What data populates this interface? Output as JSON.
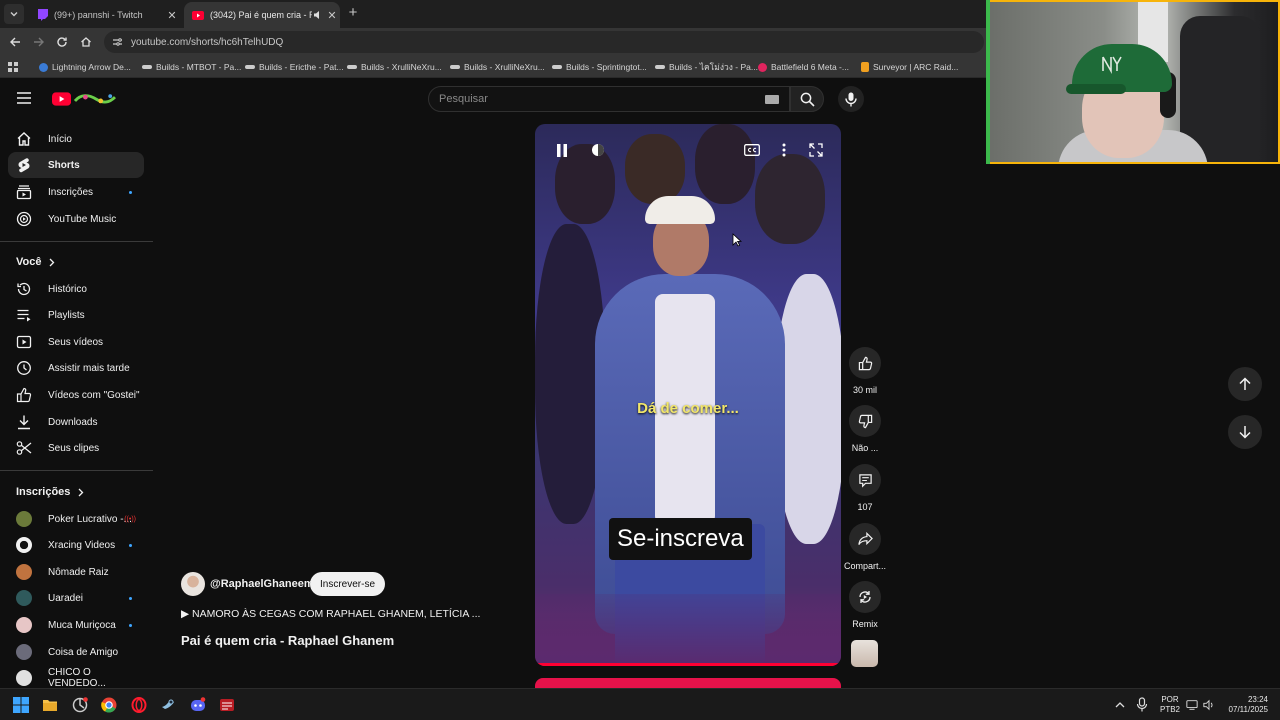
{
  "browser": {
    "tabs": [
      {
        "title": "(99+) pannshi - Twitch",
        "close": "✕"
      },
      {
        "title": "(3042) Pai é quem cria - Rap",
        "close": "✕"
      }
    ],
    "new_tab": "+",
    "url": "youtube.com/shorts/hc6hTelhUDQ",
    "bookmarks": [
      {
        "label": "Lightning Arrow De...",
        "color": "#3a7bd5"
      },
      {
        "label": "Builds - MTBOT - Pa...",
        "color": "#cccccc"
      },
      {
        "label": "Builds - Ericthe - Pat...",
        "color": "#cccccc"
      },
      {
        "label": "Builds - XrulliNeXru...",
        "color": "#cccccc"
      },
      {
        "label": "Builds - XrulliNeXru...",
        "color": "#cccccc"
      },
      {
        "label": "Builds - Sprintingtot...",
        "color": "#cccccc"
      },
      {
        "label": "Builds - ไคโม่ง่วง - Pa...",
        "color": "#cccccc"
      },
      {
        "label": "Battlefield 6 Meta -...",
        "color": "#e0245e"
      },
      {
        "label": "Surveyor | ARC Raid...",
        "color": "#f0a020"
      }
    ]
  },
  "header": {
    "search_placeholder": "Pesquisar"
  },
  "sidebar": {
    "main": [
      {
        "label": "Início",
        "icon": "home-icon"
      },
      {
        "label": "Shorts",
        "icon": "shorts-icon",
        "active": true
      },
      {
        "label": "Inscrições",
        "icon": "subscriptions-icon"
      },
      {
        "label": "YouTube Music",
        "icon": "youtube-music-icon"
      }
    ],
    "you_heading": "Você",
    "you_items": [
      {
        "label": "Histórico",
        "icon": "history-icon"
      },
      {
        "label": "Playlists",
        "icon": "playlists-icon"
      },
      {
        "label": "Seus vídeos",
        "icon": "your-videos-icon"
      },
      {
        "label": "Assistir mais tarde",
        "icon": "watch-later-icon"
      },
      {
        "label": "Vídeos com \"Gostei\"",
        "icon": "liked-videos-icon"
      },
      {
        "label": "Downloads",
        "icon": "downloads-icon"
      },
      {
        "label": "Seus clipes",
        "icon": "clips-icon"
      }
    ],
    "subs_heading": "Inscrições",
    "subs": [
      {
        "label": "Poker Lucrativo -...",
        "color": "#6b7a3a",
        "live": "((•))"
      },
      {
        "label": "Xracing Videos",
        "color": "#f1f1f1"
      },
      {
        "label": "Nômade Raiz",
        "color": "#c0733f"
      },
      {
        "label": "Uaradei",
        "color": "#2f5a5c"
      },
      {
        "label": "Muca Muriçoca",
        "color": "#e7c6c6"
      },
      {
        "label": "Coisa de Amigo",
        "color": "#6b6b7a"
      },
      {
        "label": "CHICO O VENDEDO...",
        "color": "#e0e0e0"
      }
    ]
  },
  "short": {
    "caption_overlay": "Dá de comer...",
    "subscribe_overlay": "Se-inscreva",
    "progress": 1.0,
    "channel": "@RaphaelGhaneem",
    "subscribe": "Inscrever-se",
    "playlist": "▶  NAMORO ÀS CEGAS COM RAPHAEL GHANEM, LETÍCIA ...",
    "title": "Pai é quem cria - Raphael Ghanem"
  },
  "actions": {
    "like_count": "30 mil",
    "dislike": "Não ...",
    "comments": "107",
    "share": "Compart...",
    "remix": "Remix"
  },
  "taskbar": {
    "lang_1": "POR",
    "lang_2": "PTB2",
    "time": "23:24",
    "date": "07/11/2025"
  }
}
